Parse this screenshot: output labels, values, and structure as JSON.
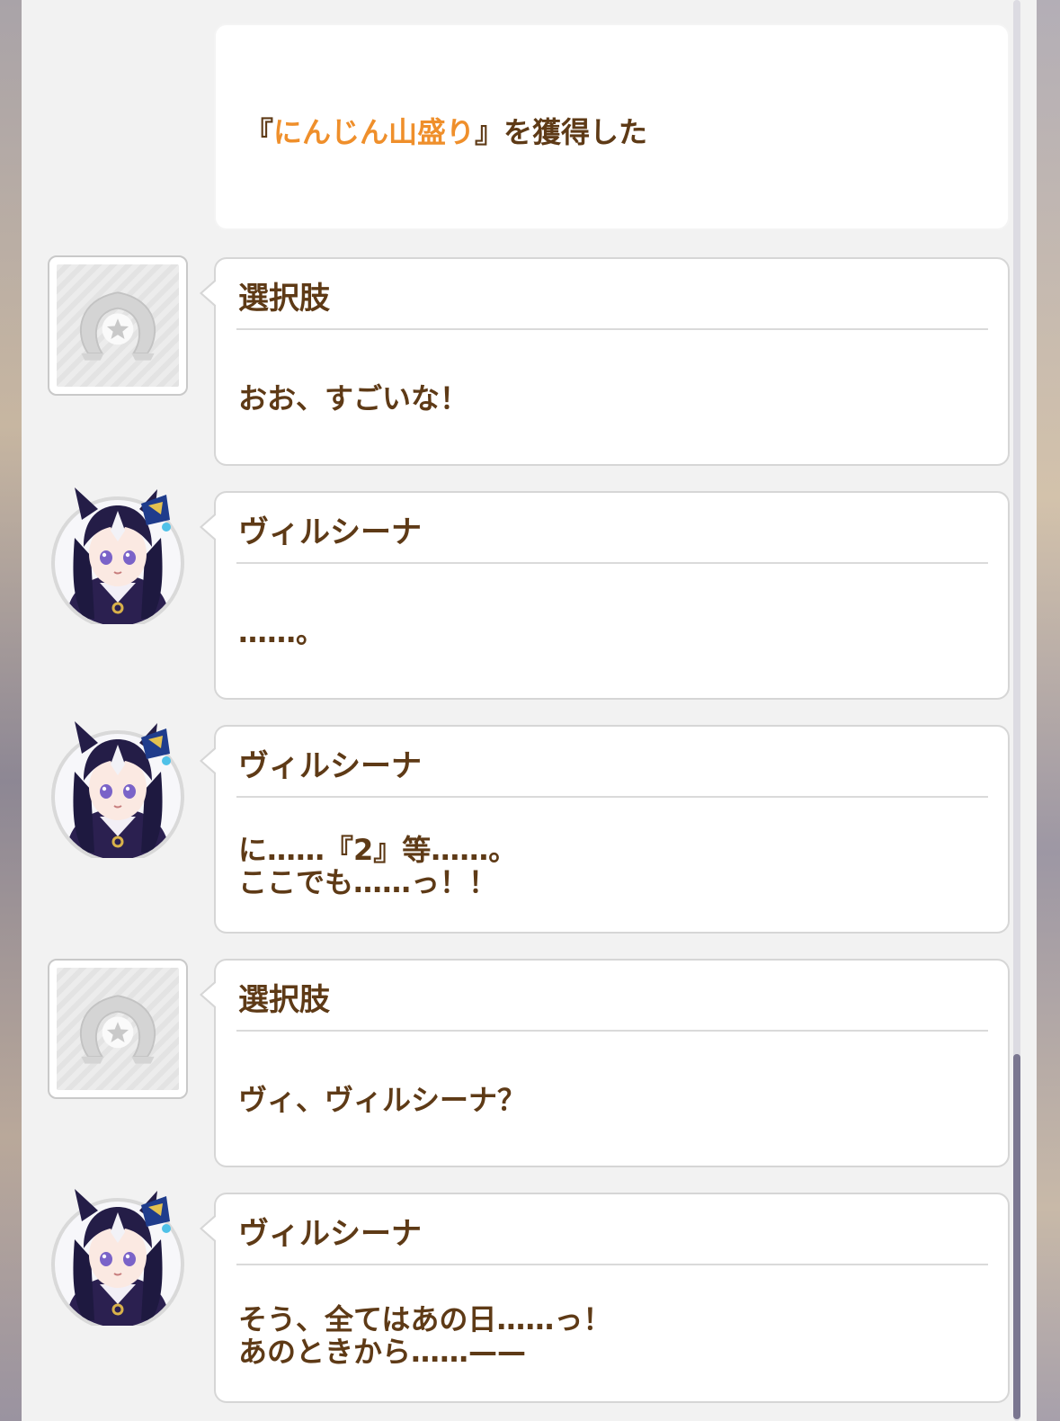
{
  "system_message": {
    "prefix": "『",
    "item": "にんじん山盛り",
    "suffix": "』を獲得した"
  },
  "messages": [
    {
      "speaker": "選択肢",
      "text_lines": [
        "おお、すごいな！"
      ]
    },
    {
      "speaker": "ヴィルシーナ",
      "text_lines": [
        "……。"
      ]
    },
    {
      "speaker": "ヴィルシーナ",
      "text_lines": [
        "に……『2』等……。",
        "ここでも……っ！！"
      ]
    },
    {
      "speaker": "選択肢",
      "text_lines": [
        "ヴィ、ヴィルシーナ？"
      ]
    },
    {
      "speaker": "ヴィルシーナ",
      "text_lines": [
        "そう、全てはあの日……っ！",
        "あのときから……——"
      ]
    }
  ],
  "icons": {
    "choice_avatar": "horseshoe-star-icon",
    "character_avatar": "vivlos-portrait"
  },
  "colors": {
    "text": "#5e3a16",
    "item_highlight": "#ef8f2b",
    "panel": "#f2f2f2",
    "scroll_thumb": "#7a7690"
  }
}
